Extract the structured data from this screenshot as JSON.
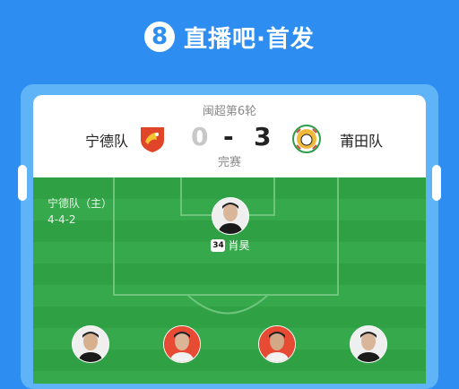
{
  "brand": {
    "logo_glyph": "8",
    "title": "直播吧·首发"
  },
  "match": {
    "round": "闽超第6轮",
    "status": "完赛",
    "home": {
      "name": "宁德队",
      "score": "0"
    },
    "away": {
      "name": "莆田队",
      "score": "3"
    },
    "score_separator": "-"
  },
  "lineup": {
    "team_label": "宁德队（主）",
    "formation": "4-4-2",
    "players": [
      {
        "number": "34",
        "name": "肖昊"
      }
    ]
  },
  "colors": {
    "header_blue": "#2d8df0",
    "frame_blue": "#5fb3f7",
    "pitch_green": "#2fa044"
  }
}
